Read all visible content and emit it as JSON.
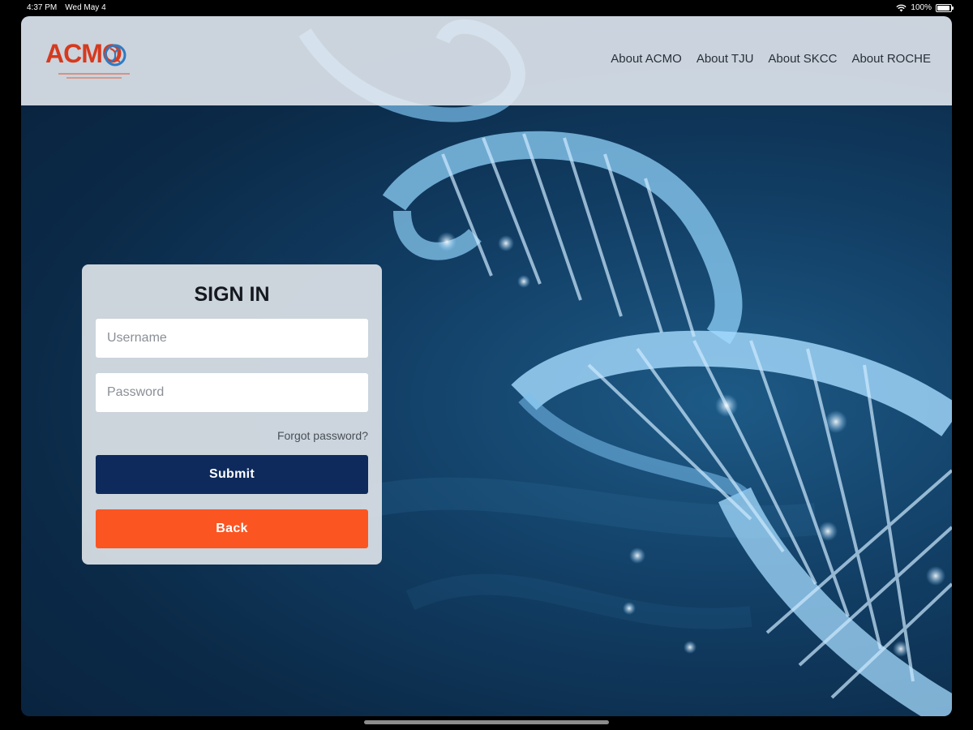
{
  "status_bar": {
    "time": "4:37 PM",
    "date": "Wed May 4",
    "battery": "100%"
  },
  "header": {
    "logo_text": "ACMO",
    "nav": [
      {
        "label": "About ACMO"
      },
      {
        "label": "About TJU"
      },
      {
        "label": "About SKCC"
      },
      {
        "label": "About ROCHE"
      }
    ]
  },
  "signin": {
    "title": "SIGN IN",
    "username_placeholder": "Username",
    "username_value": "",
    "password_placeholder": "Password",
    "password_value": "",
    "forgot_label": "Forgot password?",
    "submit_label": "Submit",
    "back_label": "Back"
  },
  "colors": {
    "submit_bg": "#0e2a5c",
    "back_bg": "#fb5522",
    "logo_red": "#d63a1e",
    "background_blue": "#0b2a48"
  },
  "icons": {
    "wifi": "wifi-icon",
    "battery": "battery-icon",
    "logo_mark": "dna-logo-icon"
  }
}
